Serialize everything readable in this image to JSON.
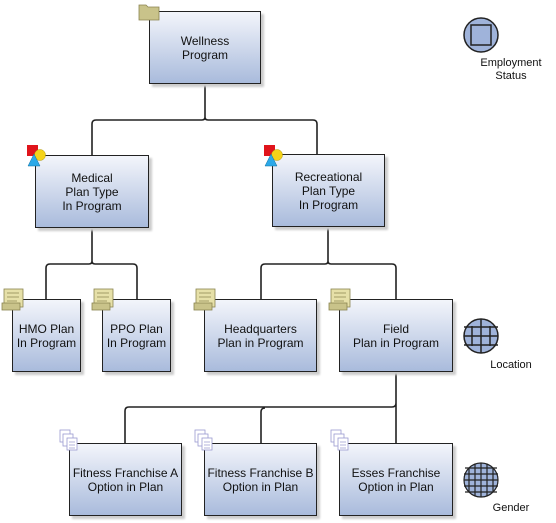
{
  "nodes": {
    "wellness": {
      "label": "Wellness\nProgram",
      "icon": "folder-icon"
    },
    "medical": {
      "label": "Medical\nPlan Type\nIn Program",
      "icon": "plan-type-icon"
    },
    "recreational": {
      "label": "Recreational\nPlan Type\nIn Program",
      "icon": "plan-type-icon"
    },
    "hmo": {
      "label": "HMO Plan\nIn Program",
      "icon": "scroll-icon"
    },
    "ppo": {
      "label": "PPO Plan\nIn Program",
      "icon": "scroll-icon"
    },
    "headquarters": {
      "label": "Headquarters\nPlan in Program",
      "icon": "scroll-icon"
    },
    "field": {
      "label": "Field\nPlan in Program",
      "icon": "scroll-icon"
    },
    "fitness_a": {
      "label": "Fitness Franchise A\nOption in Plan",
      "icon": "documents-icon"
    },
    "fitness_b": {
      "label": "Fitness Franchise B\nOption in Plan",
      "icon": "documents-icon"
    },
    "esses": {
      "label": "Esses Franchise\nOption in Plan",
      "icon": "documents-icon"
    }
  },
  "legend": {
    "employment_status": "Employment\nStatus",
    "location": "Location",
    "gender": "Gender"
  },
  "colors": {
    "node_fill_top": "#f3f5fb",
    "node_fill_bottom": "#a9bbdc",
    "legend_fill": "#9fb3da",
    "connector": "#222222"
  }
}
